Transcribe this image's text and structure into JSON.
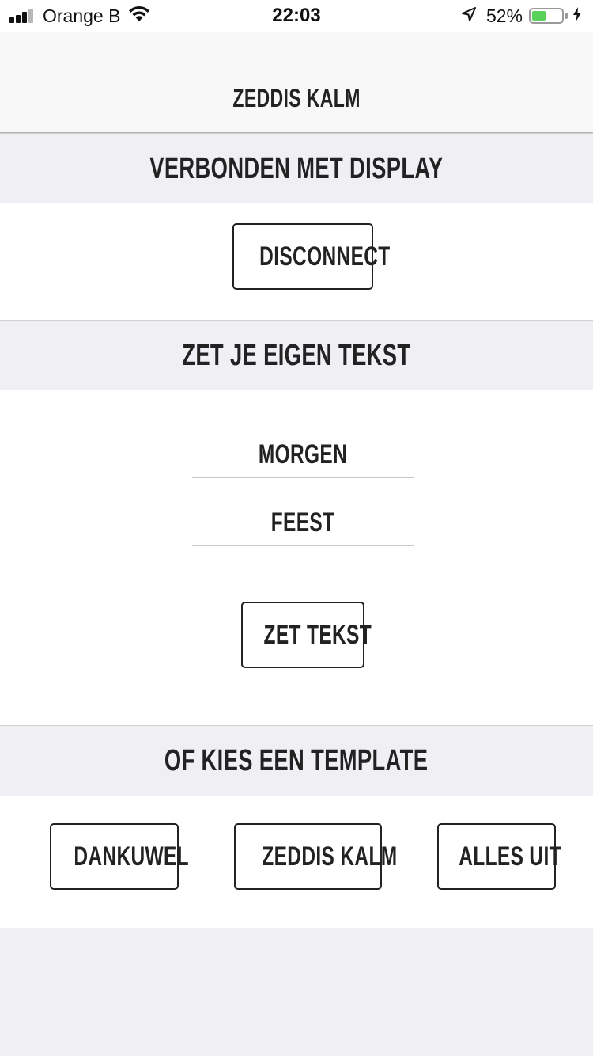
{
  "status_bar": {
    "carrier": "Orange B",
    "time": "22:03",
    "battery_percent": "52%",
    "battery_level": 0.52,
    "icons": [
      "signal-icon",
      "wifi-icon",
      "location-arrow-icon",
      "battery-icon",
      "charging-bolt-icon"
    ]
  },
  "nav": {
    "title": "ZEDDIS KALM"
  },
  "sections": {
    "connection": {
      "header": "VERBONDEN MET DISPLAY",
      "disconnect_label": "DISCONNECT"
    },
    "custom_text": {
      "header": "ZET JE EIGEN TEKST",
      "line1_value": "MORGEN",
      "line2_value": "FEEST",
      "submit_label": "ZET TEKST"
    },
    "templates": {
      "header": "OF KIES EEN TEMPLATE",
      "buttons": [
        {
          "label": "DANKUWEL"
        },
        {
          "label": "ZEDDIS KALM"
        },
        {
          "label": "ALLES UIT"
        }
      ]
    }
  },
  "colors": {
    "header_bg": "#efeff4",
    "panel_bg": "#ffffff",
    "text": "#222222",
    "battery_fill": "#5ad15a"
  }
}
